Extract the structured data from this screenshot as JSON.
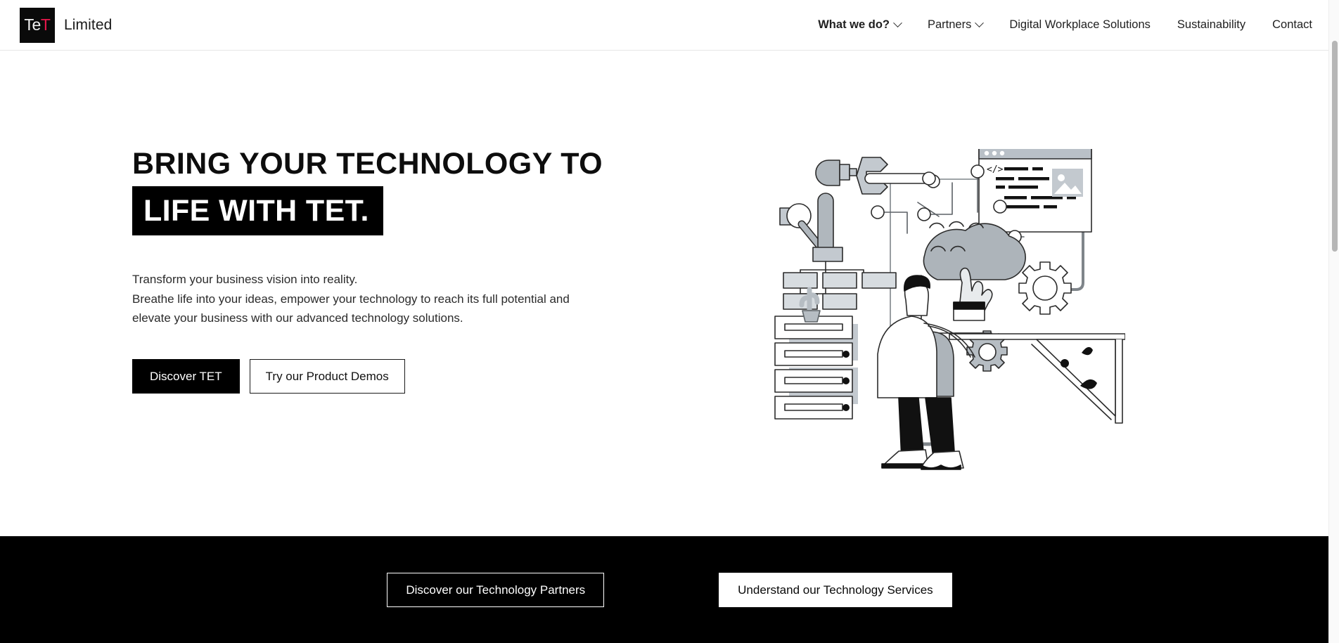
{
  "header": {
    "brand": {
      "mark_te": "Te",
      "mark_t": "T",
      "name": "Limited",
      "mark_bg": "#0a0a0a",
      "accent_color": "#e8174b"
    },
    "nav": [
      {
        "label": "What we do?",
        "bold": true,
        "has_chevron": true
      },
      {
        "label": "Partners",
        "bold": false,
        "has_chevron": true
      },
      {
        "label": "Digital Workplace Solutions",
        "bold": false,
        "has_chevron": false
      },
      {
        "label": "Sustainability",
        "bold": false,
        "has_chevron": false
      },
      {
        "label": "Contact",
        "bold": false,
        "has_chevron": false
      }
    ]
  },
  "hero": {
    "headline_line1": "BRING YOUR TECHNOLOGY TO",
    "headline_line2": "LIFE WITH TET.",
    "paragraph_lines": [
      "Transform your business vision into reality.",
      "Breathe life into your ideas, empower your technology to reach its full potential and",
      "elevate your business with our advanced technology solutions."
    ],
    "primary_cta": "Discover TET",
    "secondary_cta": "Try our Product Demos",
    "illustration_alt": "developer-at-desk-with-robot-arm-cloud-and-servers-illustration"
  },
  "footer": {
    "background": "#000000",
    "ghost_cta": "Discover our Technology Partners",
    "solid_cta": "Understand our Technology Services"
  }
}
